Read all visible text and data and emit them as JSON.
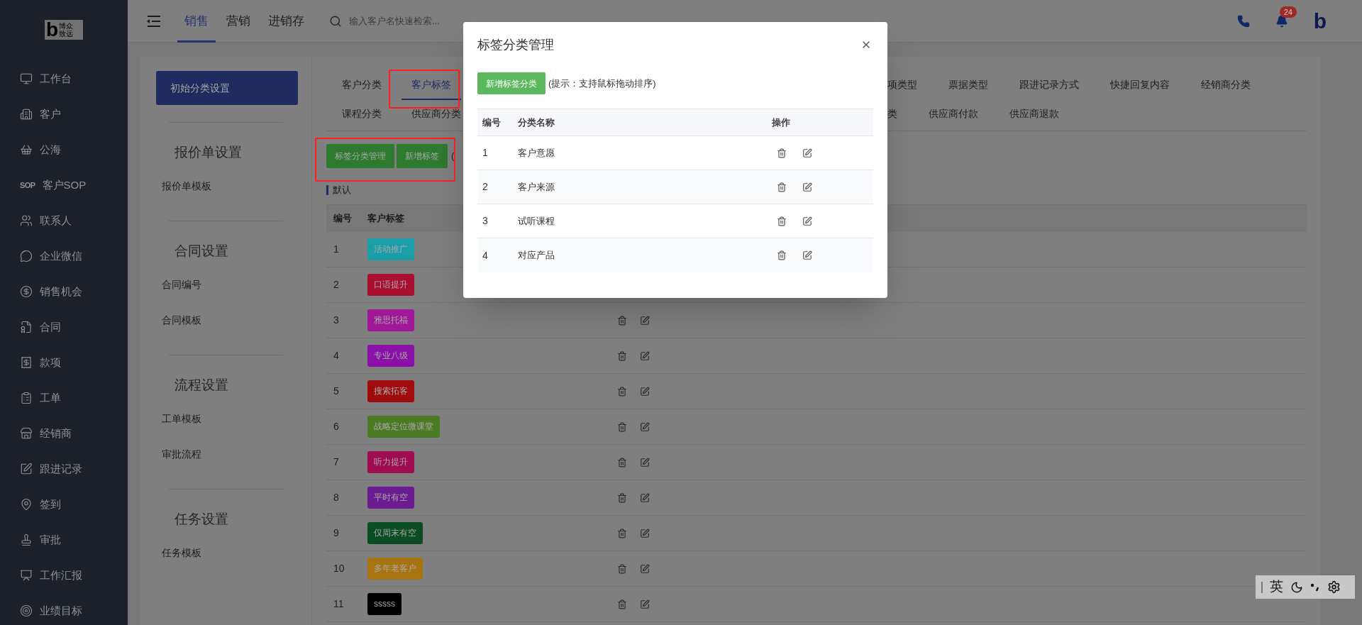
{
  "sidebar": {
    "logo": {
      "mark": "b",
      "lines": [
        "博众",
        "致远"
      ]
    },
    "items": [
      {
        "label": "工作台"
      },
      {
        "label": "客户"
      },
      {
        "label": "公海"
      },
      {
        "label": "客户SOP",
        "icon_text": "SOP"
      },
      {
        "label": "联系人"
      },
      {
        "label": "企业微信"
      },
      {
        "label": "销售机会"
      },
      {
        "label": "合同"
      },
      {
        "label": "款项"
      },
      {
        "label": "工单"
      },
      {
        "label": "经销商"
      },
      {
        "label": "跟进记录"
      },
      {
        "label": "签到"
      },
      {
        "label": "审批"
      },
      {
        "label": "工作汇报"
      },
      {
        "label": "业绩目标"
      }
    ]
  },
  "topbar": {
    "tabs": [
      {
        "label": "销售",
        "selected": true
      },
      {
        "label": "营销",
        "selected": false
      },
      {
        "label": "进销存",
        "selected": false
      }
    ],
    "search": {
      "placeholder": "输入客户名快速检索..."
    },
    "notifications": {
      "count": "24"
    },
    "brand_mark": "b"
  },
  "settings_nav": {
    "active_item": "初始分类设置",
    "groups": [
      {
        "title": "报价单设置",
        "items": [
          "报价单模板"
        ]
      },
      {
        "title": "合同设置",
        "items": [
          "合同编号",
          "合同模板"
        ]
      },
      {
        "title": "流程设置",
        "items": [
          "工单模板",
          "审批流程"
        ]
      },
      {
        "title": "任务设置",
        "items": [
          "任务模板"
        ]
      }
    ]
  },
  "category_tabs": {
    "rows": [
      {
        "tabs": [
          {
            "label": "客户分类",
            "selected": false
          },
          {
            "label": "客户标签",
            "selected": true
          }
        ],
        "tabs_after_dialog": [
          {
            "label": "项类型",
            "selected": false
          },
          {
            "label": "票据类型",
            "selected": false
          },
          {
            "label": "跟进记录方式",
            "selected": false
          },
          {
            "label": "快捷回复内容",
            "selected": false
          },
          {
            "label": "经销商分类",
            "selected": false
          }
        ]
      },
      {
        "tabs": [
          {
            "label": "课程分类",
            "selected": false
          },
          {
            "label": "供应商分类",
            "selected": false
          }
        ],
        "tabs_after_dialog": [
          {
            "label": "类",
            "selected": false
          },
          {
            "label": "供应商付款",
            "selected": false
          },
          {
            "label": "供应商退款",
            "selected": false
          }
        ]
      }
    ]
  },
  "toolbar": {
    "buttons": [
      "标签分类管理",
      "新增标签"
    ],
    "hint": "("
  },
  "tag_group": {
    "title": "默认",
    "columns": [
      "编号",
      "客户标签"
    ],
    "rows": [
      {
        "no": "1",
        "tag": "活动推广",
        "color": "#1a9ea8"
      },
      {
        "no": "2",
        "tag": "口语提升",
        "color": "#a8102e"
      },
      {
        "no": "3",
        "tag": "雅思托福",
        "color": "#a01898"
      },
      {
        "no": "4",
        "tag": "专业八级",
        "color": "#8a10a8"
      },
      {
        "no": "5",
        "tag": "搜索拓客",
        "color": "#a00c0c"
      },
      {
        "no": "6",
        "tag": "战略定位微课堂",
        "color": "#4a7a22"
      },
      {
        "no": "7",
        "tag": "听力提升",
        "color": "#a00c50"
      },
      {
        "no": "8",
        "tag": "平时有空",
        "color": "#6a1c90"
      },
      {
        "no": "9",
        "tag": "仅周末有空",
        "color": "#0b4d22"
      },
      {
        "no": "10",
        "tag": "多年老客户",
        "color": "#a87410"
      },
      {
        "no": "11",
        "tag": "sssss",
        "color": "#000000"
      }
    ]
  },
  "dialog": {
    "title": "标签分类管理",
    "add_button": "新增标签分类",
    "hint": "(提示：支持鼠标拖动排序)",
    "columns": [
      "编号",
      "分类名称",
      "操作"
    ],
    "rows": [
      {
        "no": "1",
        "name": "客户意愿"
      },
      {
        "no": "2",
        "name": "客户来源"
      },
      {
        "no": "3",
        "name": "试听课程"
      },
      {
        "no": "4",
        "name": "对应产品"
      }
    ]
  },
  "ime": {
    "mode": "英"
  }
}
